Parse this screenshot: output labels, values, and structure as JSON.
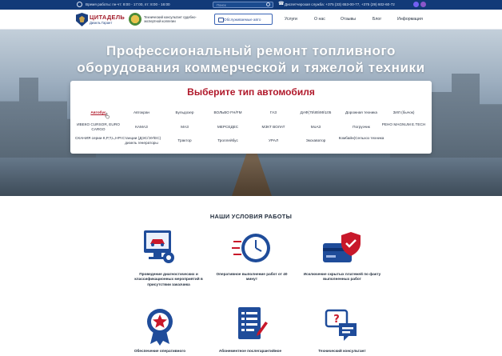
{
  "topbar": {
    "hours": "Время работы: пн-чт: 8:00 - 17:00, пт: 8:00 - 16:00",
    "search_placeholder": "Поиск",
    "phones": "Диспетчерская служба: +375 (33) 653-00-77, +375 (29) 602-60-72"
  },
  "header": {
    "brand": "ЦИТАДЕЛЬ",
    "brand_sub": "Дизель Гарант",
    "consultant": "Технический консультант судебно-экспертной коллегии",
    "service_button": "Обслуживаемые авто",
    "nav": [
      "Услуги",
      "О нас",
      "Отзывы",
      "Блог",
      "Информация"
    ]
  },
  "hero": {
    "title_line1": "Профессиональный ремонт топливного",
    "title_line2": "оборудования коммерческой и тяжелой техники"
  },
  "vehicle_panel": {
    "title": "Выберите тип автомобиля",
    "items": [
      "Автобус",
      "Автокран",
      "Бульдозер",
      "ВОЛЬВО FH/FM",
      "ГАЗ",
      "ДАФ(75\\85\\95\\105",
      "Дорожная техника",
      "ЗИЛ (бычок)",
      "ИВЕКО CURSOR, EURO CARGO",
      "КАМАЗ",
      "МАЗ",
      "МЕРСЕДЕС",
      "МЗКТ ВОЛАТ",
      "МоАЗ",
      "Погрузчик",
      "РЕНО MAGNUM E.TECH",
      "СКАНИЯ серии К,P,T,L,HPI",
      "Станции (ДЭС/ЭУ/ЕС) дизель генераторы",
      "Трактор",
      "Троллейбус",
      "УРАЛ",
      "Экскаватор",
      "Комбайн(Сельхоз техника"
    ],
    "active_item": "Автобус"
  },
  "conditions": {
    "title": "НАШИ УСЛОВИЯ РАБОТЫ",
    "items": [
      "Проведение диагностических и классификационных мероприятий в присутствии заказчика",
      "Оперативное выполнение работ от 40 минут",
      "Исключение скрытых платежей по факту выполненных работ",
      "Обеспечение оперативного",
      "Абонементное послегарантийное",
      "Технический консультант"
    ]
  },
  "colors": {
    "brand_blue": "#123a78",
    "accent_red": "#b0182a",
    "icon_blue": "#1f4c9a"
  }
}
